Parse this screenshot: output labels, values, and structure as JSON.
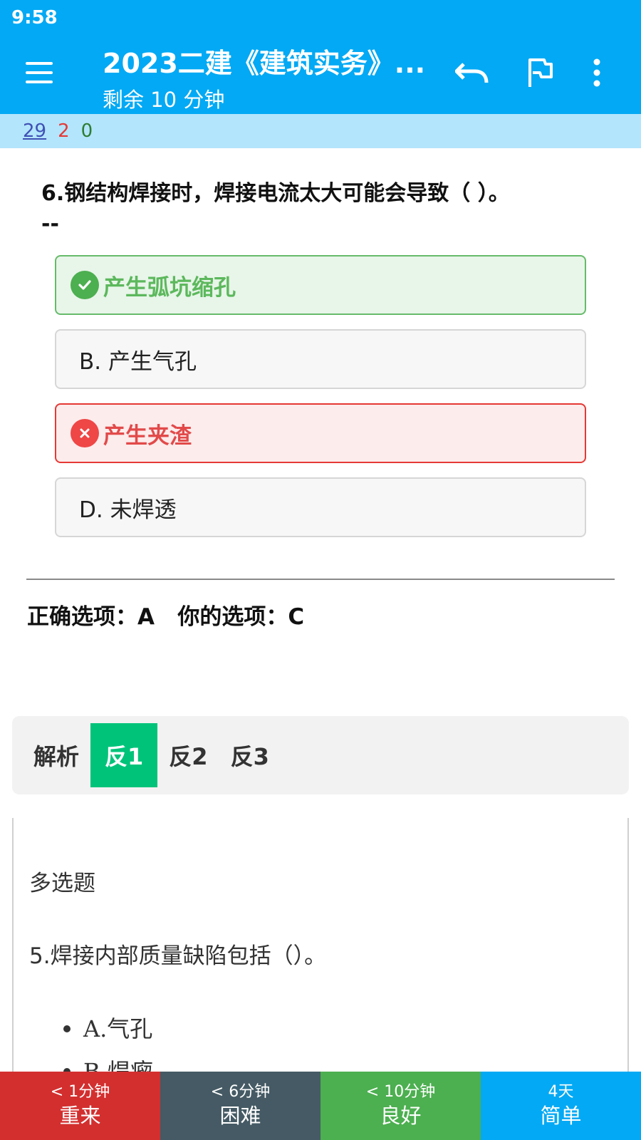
{
  "status": {
    "time": "9:58"
  },
  "header": {
    "title": "2023二建《建筑实务》...",
    "subtitle": "剩余 10 分钟",
    "icons": [
      "menu-icon",
      "undo-icon",
      "flag-icon",
      "more-vert-icon"
    ]
  },
  "counters": {
    "new": "29",
    "learning": "2",
    "review": "0"
  },
  "question": {
    "text": "6.钢结构焊接时，焊接电流太大可能会导致（ ）。",
    "suffix": "--",
    "options": [
      {
        "label": "产生弧坑缩孔",
        "state": "correct",
        "icon": "check-circle-icon"
      },
      {
        "label": "B. 产生气孔",
        "state": "normal"
      },
      {
        "label": "产生夹渣",
        "state": "wrong",
        "icon": "x-circle-icon"
      },
      {
        "label": "D. 未焊透",
        "state": "normal"
      }
    ]
  },
  "answer": {
    "correct_label": "正确选项：A",
    "yours_label": "你的选项：C"
  },
  "tabs": [
    {
      "label": "解析",
      "active": false
    },
    {
      "label": "反1",
      "active": true
    },
    {
      "label": "反2",
      "active": false
    },
    {
      "label": "反3",
      "active": false
    }
  ],
  "panel": {
    "type": "多选题",
    "question": "5.焊接内部质量缺陷包括（）。",
    "items": [
      "A.气孔",
      "B.焊瘤"
    ]
  },
  "bottom_buttons": [
    {
      "time": "< 1分钟",
      "label": "重来",
      "color": "#d32f2f"
    },
    {
      "time": "< 6分钟",
      "label": "困难",
      "color": "#455a64"
    },
    {
      "time": "< 10分钟",
      "label": "良好",
      "color": "#4caf50"
    },
    {
      "time": "4天",
      "label": "简单",
      "color": "#03a9f4"
    }
  ],
  "colors": {
    "appbar": "#03a9f4",
    "counter_bar": "#b3e5fc",
    "correct": "#4caf50",
    "wrong": "#e53935",
    "active_tab": "#00c37a"
  }
}
